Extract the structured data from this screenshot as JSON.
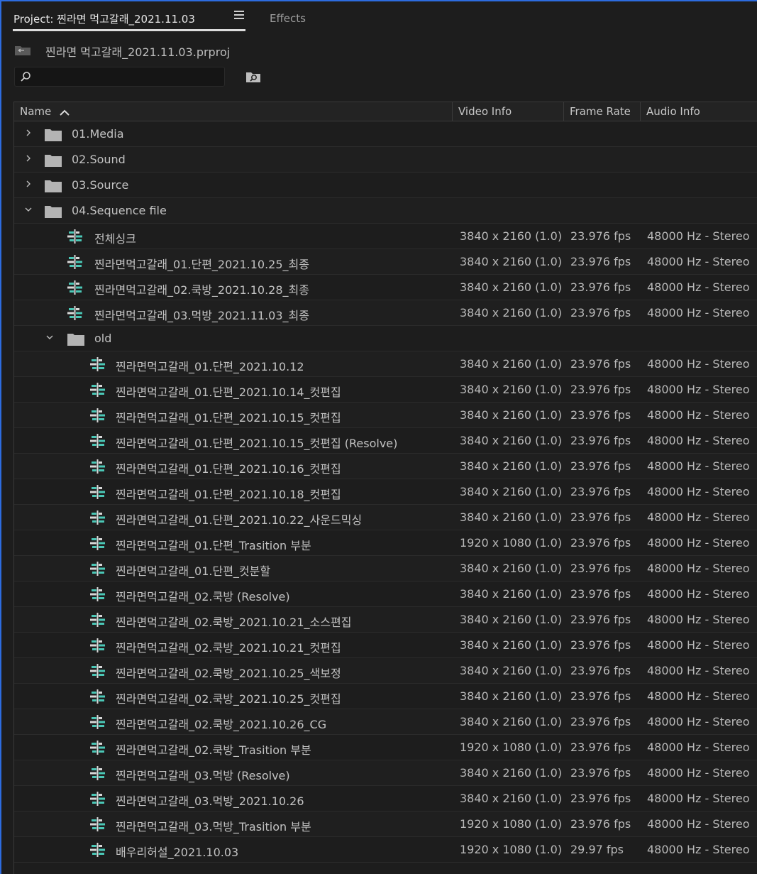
{
  "tabs": {
    "project": "Project: 찐라면 먹고갈래_2021.11.03",
    "effects": "Effects"
  },
  "project_file": "찐라면 먹고갈래_2021.11.03.prproj",
  "search": {
    "value": "",
    "placeholder": ""
  },
  "columns": {
    "name": "Name",
    "video": "Video Info",
    "frame": "Frame Rate",
    "audio": "Audio Info"
  },
  "icons": {
    "tab_menu": "hamburger-menu-icon",
    "project_file": "project-file-icon",
    "search": "search-icon",
    "bin_search": "find-in-bin-icon",
    "sort": "sort-ascending-icon",
    "folder": "folder-icon",
    "sequence": "sequence-icon"
  },
  "colors": {
    "accent": "#2d6cdf",
    "sequence_icon": "#4bc7b6",
    "folder": "#b4b4b4"
  },
  "rows": [
    {
      "type": "folder",
      "depth": 0,
      "expanded": false,
      "name": "01.Media"
    },
    {
      "type": "folder",
      "depth": 0,
      "expanded": false,
      "name": "02.Sound"
    },
    {
      "type": "folder",
      "depth": 0,
      "expanded": false,
      "name": "03.Source"
    },
    {
      "type": "folder",
      "depth": 0,
      "expanded": true,
      "name": "04.Sequence file"
    },
    {
      "type": "seq",
      "depth": 1,
      "name": "전체싱크",
      "video": "3840 x 2160 (1.0)",
      "frame": "23.976 fps",
      "audio": "48000 Hz - Stereo"
    },
    {
      "type": "seq",
      "depth": 1,
      "name": "찐라면먹고갈래_01.단편_2021.10.25_최종",
      "video": "3840 x 2160 (1.0)",
      "frame": "23.976 fps",
      "audio": "48000 Hz - Stereo"
    },
    {
      "type": "seq",
      "depth": 1,
      "name": "찐라면먹고갈래_02.쿡방_2021.10.28_최종",
      "video": "3840 x 2160 (1.0)",
      "frame": "23.976 fps",
      "audio": "48000 Hz - Stereo"
    },
    {
      "type": "seq",
      "depth": 1,
      "name": "찐라면먹고갈래_03.먹방_2021.11.03_최종",
      "video": "3840 x 2160 (1.0)",
      "frame": "23.976 fps",
      "audio": "48000 Hz - Stereo"
    },
    {
      "type": "folder",
      "depth": 1,
      "expanded": true,
      "name": "old"
    },
    {
      "type": "seq",
      "depth": 2,
      "name": "찐라면먹고갈래_01.단편_2021.10.12",
      "video": "3840 x 2160 (1.0)",
      "frame": "23.976 fps",
      "audio": "48000 Hz - Stereo"
    },
    {
      "type": "seq",
      "depth": 2,
      "name": "찐라면먹고갈래_01.단편_2021.10.14_컷편집",
      "video": "3840 x 2160 (1.0)",
      "frame": "23.976 fps",
      "audio": "48000 Hz - Stereo"
    },
    {
      "type": "seq",
      "depth": 2,
      "name": "찐라면먹고갈래_01.단편_2021.10.15_컷편집",
      "video": "3840 x 2160 (1.0)",
      "frame": "23.976 fps",
      "audio": "48000 Hz - Stereo"
    },
    {
      "type": "seq",
      "depth": 2,
      "name": "찐라면먹고갈래_01.단편_2021.10.15_컷편집 (Resolve)",
      "video": "3840 x 2160 (1.0)",
      "frame": "23.976 fps",
      "audio": "48000 Hz - Stereo"
    },
    {
      "type": "seq",
      "depth": 2,
      "name": "찐라면먹고갈래_01.단편_2021.10.16_컷편집",
      "video": "3840 x 2160 (1.0)",
      "frame": "23.976 fps",
      "audio": "48000 Hz - Stereo"
    },
    {
      "type": "seq",
      "depth": 2,
      "name": "찐라면먹고갈래_01.단편_2021.10.18_컷편집",
      "video": "3840 x 2160 (1.0)",
      "frame": "23.976 fps",
      "audio": "48000 Hz - Stereo"
    },
    {
      "type": "seq",
      "depth": 2,
      "name": "찐라면먹고갈래_01.단편_2021.10.22_사운드믹싱",
      "video": "3840 x 2160 (1.0)",
      "frame": "23.976 fps",
      "audio": "48000 Hz - Stereo"
    },
    {
      "type": "seq",
      "depth": 2,
      "name": "찐라면먹고갈래_01.단편_Trasition 부분",
      "video": "1920 x 1080 (1.0)",
      "frame": "23.976 fps",
      "audio": "48000 Hz - Stereo"
    },
    {
      "type": "seq",
      "depth": 2,
      "name": "찐라면먹고갈래_01.단편_컷분할",
      "video": "3840 x 2160 (1.0)",
      "frame": "23.976 fps",
      "audio": "48000 Hz - Stereo"
    },
    {
      "type": "seq",
      "depth": 2,
      "name": "찐라면먹고갈래_02.쿡방 (Resolve)",
      "video": "3840 x 2160 (1.0)",
      "frame": "23.976 fps",
      "audio": "48000 Hz - Stereo"
    },
    {
      "type": "seq",
      "depth": 2,
      "name": "찐라면먹고갈래_02.쿡방_2021.10.21_소스편집",
      "video": "3840 x 2160 (1.0)",
      "frame": "23.976 fps",
      "audio": "48000 Hz - Stereo"
    },
    {
      "type": "seq",
      "depth": 2,
      "name": "찐라면먹고갈래_02.쿡방_2021.10.21_컷편집",
      "video": "3840 x 2160 (1.0)",
      "frame": "23.976 fps",
      "audio": "48000 Hz - Stereo"
    },
    {
      "type": "seq",
      "depth": 2,
      "name": "찐라면먹고갈래_02.쿡방_2021.10.25_색보정",
      "video": "3840 x 2160 (1.0)",
      "frame": "23.976 fps",
      "audio": "48000 Hz - Stereo"
    },
    {
      "type": "seq",
      "depth": 2,
      "name": "찐라면먹고갈래_02.쿡방_2021.10.25_컷편집",
      "video": "3840 x 2160 (1.0)",
      "frame": "23.976 fps",
      "audio": "48000 Hz - Stereo"
    },
    {
      "type": "seq",
      "depth": 2,
      "name": "찐라면먹고갈래_02.쿡방_2021.10.26_CG",
      "video": "3840 x 2160 (1.0)",
      "frame": "23.976 fps",
      "audio": "48000 Hz - Stereo"
    },
    {
      "type": "seq",
      "depth": 2,
      "name": "찐라면먹고갈래_02.쿡방_Trasition 부분",
      "video": "1920 x 1080 (1.0)",
      "frame": "23.976 fps",
      "audio": "48000 Hz - Stereo"
    },
    {
      "type": "seq",
      "depth": 2,
      "name": "찐라면먹고갈래_03.먹방 (Resolve)",
      "video": "3840 x 2160 (1.0)",
      "frame": "23.976 fps",
      "audio": "48000 Hz - Stereo"
    },
    {
      "type": "seq",
      "depth": 2,
      "name": "찐라면먹고갈래_03.먹방_2021.10.26",
      "video": "3840 x 2160 (1.0)",
      "frame": "23.976 fps",
      "audio": "48000 Hz - Stereo"
    },
    {
      "type": "seq",
      "depth": 2,
      "name": "찐라면먹고갈래_03.먹방_Trasition 부분",
      "video": "1920 x 1080 (1.0)",
      "frame": "23.976 fps",
      "audio": "48000 Hz - Stereo"
    },
    {
      "type": "seq",
      "depth": 2,
      "name": "배우리허설_2021.10.03",
      "video": "1920 x 1080 (1.0)",
      "frame": "29.97 fps",
      "audio": "48000 Hz - Stereo"
    }
  ]
}
